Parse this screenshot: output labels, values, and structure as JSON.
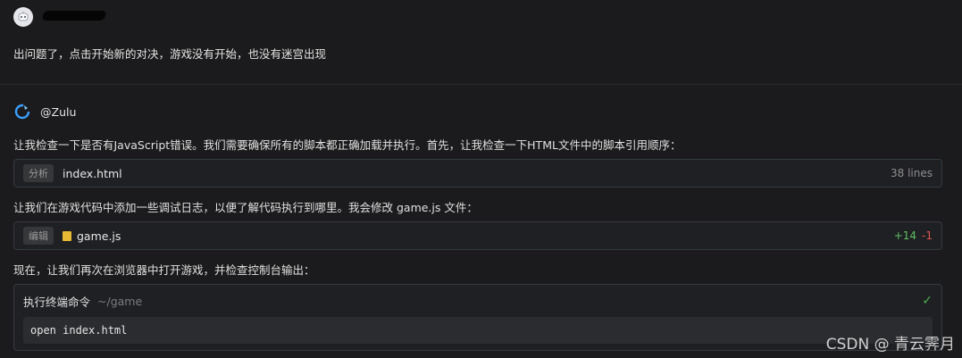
{
  "user_message": {
    "text": "出问题了，点击开始新的对决，游戏没有开始，也没有迷宫出现"
  },
  "assistant": {
    "name": "@Zulu",
    "para1": "让我检查一下是否有JavaScript错误。我们需要确保所有的脚本都正确加载并执行。首先，让我检查一下HTML文件中的脚本引用顺序：",
    "tool1": {
      "tag": "分析",
      "file": "index.html",
      "meta": "38 lines"
    },
    "para2": "让我们在游戏代码中添加一些调试日志，以便了解代码执行到哪里。我会修改 game.js 文件：",
    "tool2": {
      "tag": "编辑",
      "file": "game.js",
      "added": "+14",
      "removed": "-1"
    },
    "para3": "现在，让我们再次在浏览器中打开游戏，并检查控制台输出：",
    "terminal": {
      "title": "执行终端命令",
      "path": "~/game",
      "command": "open index.html"
    }
  },
  "watermark": "CSDN @ 青云霁月",
  "colors": {
    "added": "#5fbf63",
    "removed": "#e05252",
    "success": "#4caf50",
    "logo": "#3aa0ff"
  }
}
